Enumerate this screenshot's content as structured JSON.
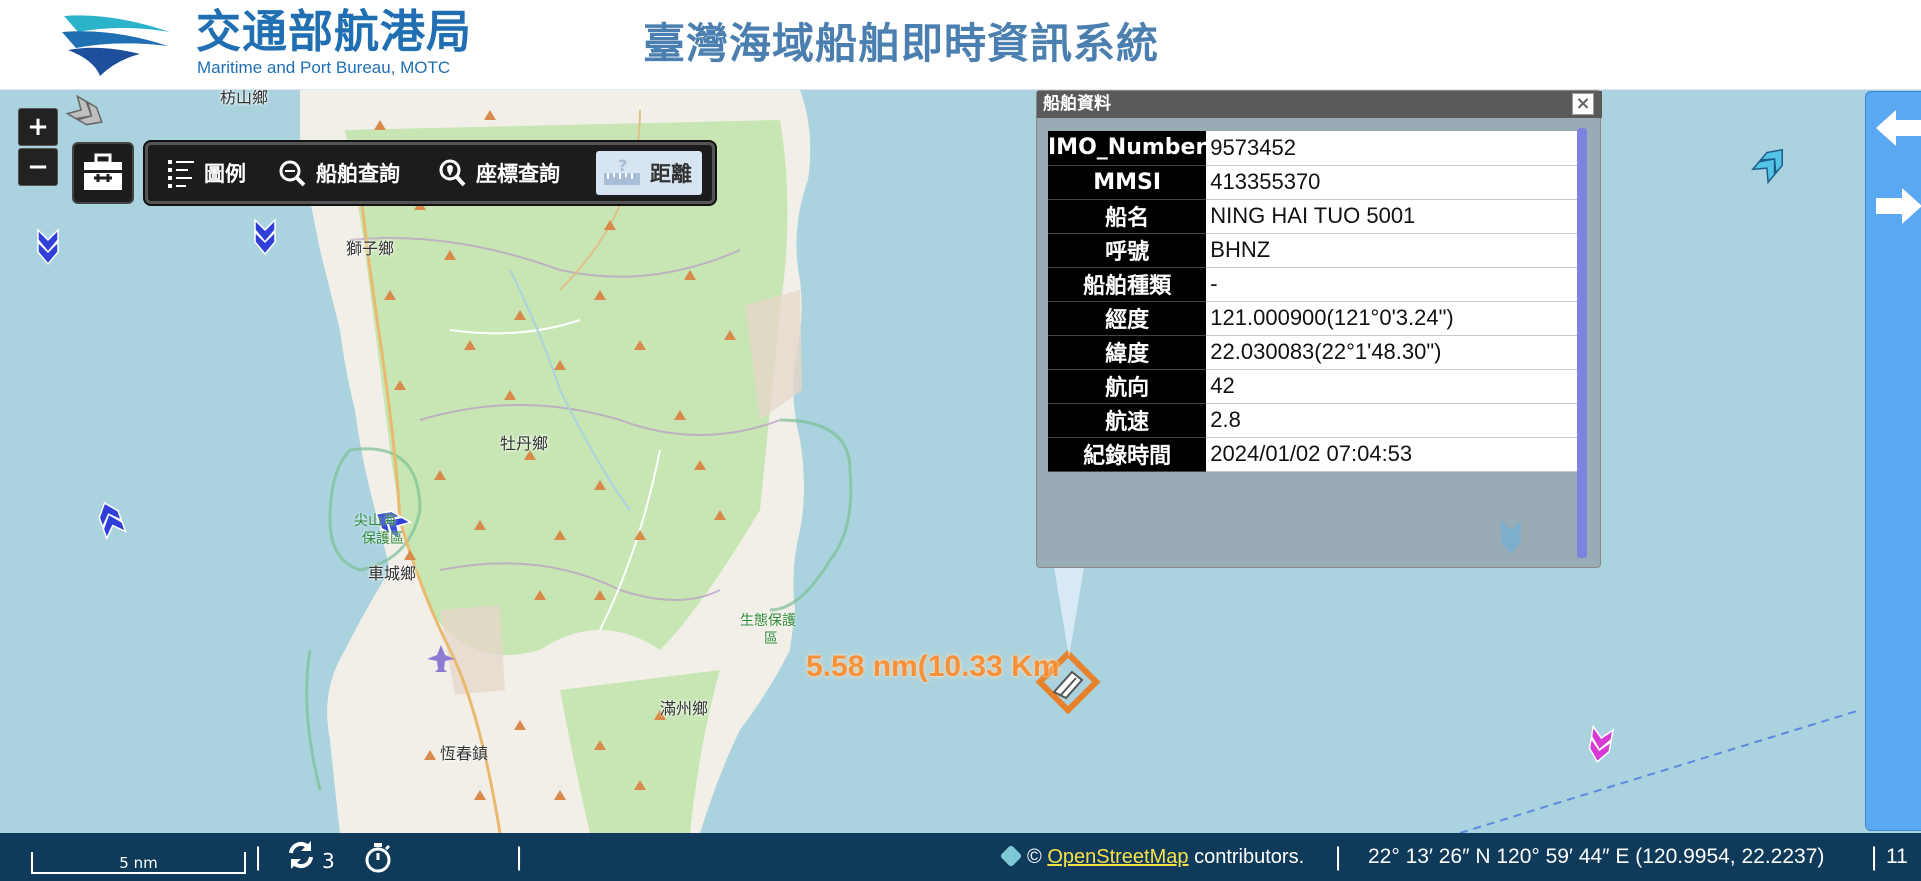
{
  "header": {
    "logo_cn": "交通部航港局",
    "logo_en": "Maritime and Port Bureau, MOTC",
    "system_title": "臺灣海域船舶即時資訊系統"
  },
  "map_controls": {
    "zoom_in": "+",
    "zoom_out": "−"
  },
  "toolbar": {
    "legend": "圖例",
    "ship_search": "船舶查詢",
    "coord_search": "座標查詢",
    "distance": "距離"
  },
  "map_labels": {
    "shizi": "獅子鄉",
    "mudan": "牡丹鄉",
    "checheng": "車城鄉",
    "hengchun": "恆春鎮",
    "manzhou": "滿州鄉",
    "eco_reserve_line1": "生態保護",
    "eco_reserve_line2": "區",
    "jianshan_line1": "尖山海",
    "jianshan_line2": "保護區",
    "top_fragment": "枋山鄉"
  },
  "ship_info": {
    "title": "船舶資料",
    "close": "×",
    "rows": [
      {
        "key": "IMO_Number",
        "value": "9573452"
      },
      {
        "key": "MMSI",
        "value": "413355370"
      },
      {
        "key": "船名",
        "value": "NING HAI TUO 5001"
      },
      {
        "key": "呼號",
        "value": "BHNZ"
      },
      {
        "key": "船舶種類",
        "value": "-"
      },
      {
        "key": "經度",
        "value": "121.000900(121°0'3.24\")"
      },
      {
        "key": "緯度",
        "value": "22.030083(22°1'48.30\")"
      },
      {
        "key": "航向",
        "value": "42"
      },
      {
        "key": "航速",
        "value": "2.8"
      },
      {
        "key": "紀錄時間",
        "value": "2024/01/02 07:04:53"
      }
    ]
  },
  "measurement": {
    "distance_text": "5.58 nm(10.33 Km"
  },
  "statusbar": {
    "scale": "5 nm",
    "refresh_count": "3",
    "osm_prefix": "©",
    "osm_link": "OpenStreetMap",
    "osm_suffix": "contributors.",
    "coordinates": "22° 13′ 26″ N 120° 59′ 44″ E (120.9954, 22.2237)",
    "zoom_level": "11",
    "separator": "|"
  },
  "colors": {
    "sea": "#aad3df",
    "land": "#f2efe9",
    "forest": "#c8e6b4",
    "header_blue": "#1f6fb2",
    "statusbar": "#103a5a",
    "measure_orange": "#ff8a2a",
    "side_panel": "#5aa8f2"
  },
  "icons": [
    "search-icon",
    "legend-icon",
    "location-pin-icon",
    "ruler-icon",
    "toolbox-icon",
    "refresh-icon",
    "timer-icon",
    "arrow-left-icon",
    "arrow-right-icon",
    "ship-icon"
  ]
}
